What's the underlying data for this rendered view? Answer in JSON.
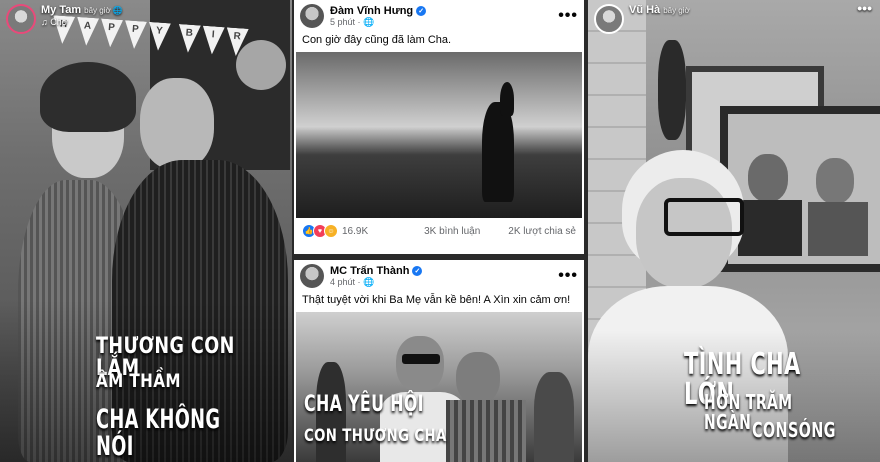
{
  "left_story": {
    "user": "My Tam",
    "time": "bây giờ",
    "music": "Chơ",
    "banner_letters": [
      "H",
      "A",
      "P",
      "P",
      "Y",
      "B",
      "I",
      "R"
    ],
    "caption_lines": [
      "THƯƠNG CON LẮM",
      "ÂM THẦM",
      "CHA KHÔNG NÓI"
    ]
  },
  "post_one": {
    "author": "Đàm Vĩnh Hưng",
    "time": "5 phút",
    "more": "•••",
    "text": "Con giờ đây cũng đã làm Cha.",
    "reactions_count": "16.9K",
    "comments": "3K bình luận",
    "shares": "2K lượt chia sẻ"
  },
  "post_two": {
    "author": "MC Trấn Thành",
    "time": "4 phút",
    "more": "•••",
    "text": "Thật tuyệt vời khi Ba Mẹ vẫn kề bên! A Xìn xin cảm ơn!",
    "caption_lines": [
      "CHA YÊU HỘI",
      "CON THƯƠNG CHA"
    ]
  },
  "right_story": {
    "user": "Vũ Hà",
    "time": "bây giờ",
    "more": "•••",
    "caption_lines": [
      "TÌNH CHA LỚN",
      "HƠN TRĂM NGÀN",
      "CONSÓNG"
    ]
  }
}
